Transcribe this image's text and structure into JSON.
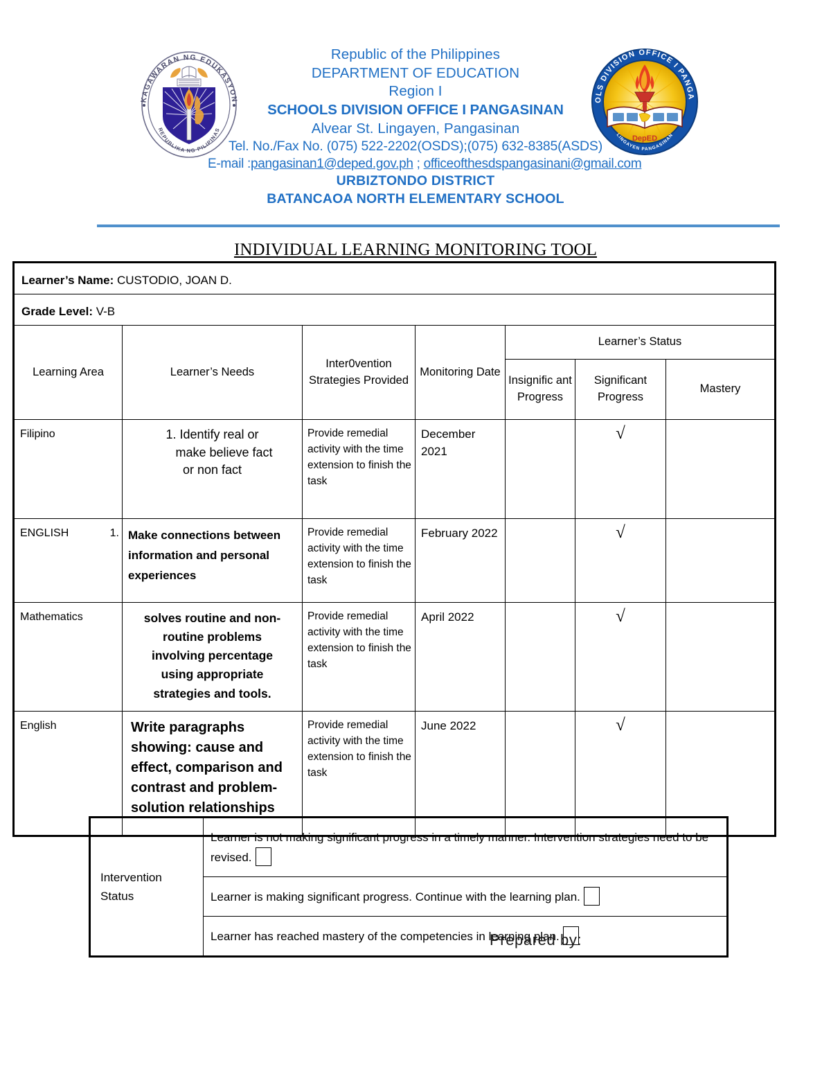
{
  "letterhead": {
    "line1": "Republic of the Philippines",
    "line2": "DEPARTMENT OF EDUCATION",
    "line3": "Region I",
    "line4": "SCHOOLS DIVISION OFFICE I PANGASINAN",
    "line5": "Alvear St. Lingayen, Pangasinan",
    "line6": "Tel. No./Fax No. (075) 522-2202(OSDS);(075) 632-8385(ASDS)",
    "email_prefix": "E-mail :",
    "email1": "pangasinan1@deped.gov.ph",
    "email_sep": " ; ",
    "email2": "officeofthesdspangasinani@gmail.com",
    "district": "URBIZTONDO DISTRICT",
    "school": "BATANCAOA NORTH ELEMENTARY SCHOOL",
    "text_color": "#1F6FC4",
    "rule_color": "#4F90CC",
    "left_seal_name": "deped-seal-icon",
    "left_seal_outer_text": "KAGAWARAN NG EDUKASYON",
    "left_seal_inner_text": "REPUBLIKA NG PILIPINAS",
    "right_seal_name": "schools-division-office-seal-icon",
    "right_seal_outer_text": "SCHOOLS DIVISION OFFICE I PANGASINAN",
    "right_seal_center_text": "DepED",
    "right_seal_bottom_text": "LINGAYEN PANGASINAN"
  },
  "document": {
    "title": "INDIVIDUAL LEARNING MONITORING TOOL"
  },
  "learner": {
    "name_label": "Learner’s Name:",
    "name_value": "CUSTODIO, JOAN D.",
    "grade_label": "Grade Level:",
    "grade_value": "V-B"
  },
  "table": {
    "headers": {
      "learning_area": "Learning Area",
      "learners_needs": "Learner’s Needs",
      "intervention_strategies": "Inter0vention Strategies Provided",
      "monitoring_date": "Monitoring Date",
      "learners_status": "Learner’s Status",
      "insignificant_progress": "Insignific ant Progress",
      "significant_progress": "Significant Progress",
      "mastery": "Mastery"
    },
    "rows": [
      {
        "learning_area": "Filipino",
        "item_number": "",
        "needs_line1": "1. Identify real or",
        "needs_line2": "make believe fact",
        "needs_line3": "or non fact",
        "strategy": "Provide remedial activity with the time extension to finish the task",
        "monitoring_date": "December 2021",
        "insignificant": "",
        "significant": "√",
        "mastery": ""
      },
      {
        "learning_area": "ENGLISH",
        "item_number": "1.",
        "needs_line1": "Make connections between",
        "needs_line2": "information and personal",
        "needs_line3": "experiences",
        "strategy": "Provide remedial activity with the time extension to finish the task",
        "monitoring_date": "February 2022",
        "insignificant": "",
        "significant": "√",
        "mastery": ""
      },
      {
        "learning_area": "Mathematics",
        "item_number": "",
        "needs_line1": "solves routine and non-",
        "needs_line2": "routine problems",
        "needs_line3": "involving percentage",
        "needs_line4": "using appropriate",
        "needs_line5": "strategies and tools.",
        "strategy": "Provide remedial activity with the time extension to finish the task",
        "monitoring_date": "April 2022",
        "insignificant": "",
        "significant": "√",
        "mastery": ""
      },
      {
        "learning_area": "English",
        "item_number": "",
        "needs_line1": "Write paragraphs",
        "needs_line2": "showing: cause and",
        "needs_line3": "effect, comparison and",
        "needs_line4": "contrast and problem-",
        "needs_line5": "solution relationships",
        "strategy": "Provide remedial activity with the time extension to finish the task",
        "monitoring_date": "June 2022",
        "insignificant": "",
        "significant": "√",
        "mastery": ""
      }
    ]
  },
  "intervention_status": {
    "label_line1": "Intervention",
    "label_line2": "Status",
    "options": [
      {
        "text": "Learner is not making significant progress in a timely manner. Intervention strategies need to be revised.",
        "checked": false
      },
      {
        "text": "Learner is making significant progress. Continue with the learning plan.",
        "checked": false
      },
      {
        "text": "Learner has reached mastery of the competencies in learning plan.",
        "checked": false
      }
    ]
  },
  "footer": {
    "prepared_by": "Prepared by:"
  }
}
